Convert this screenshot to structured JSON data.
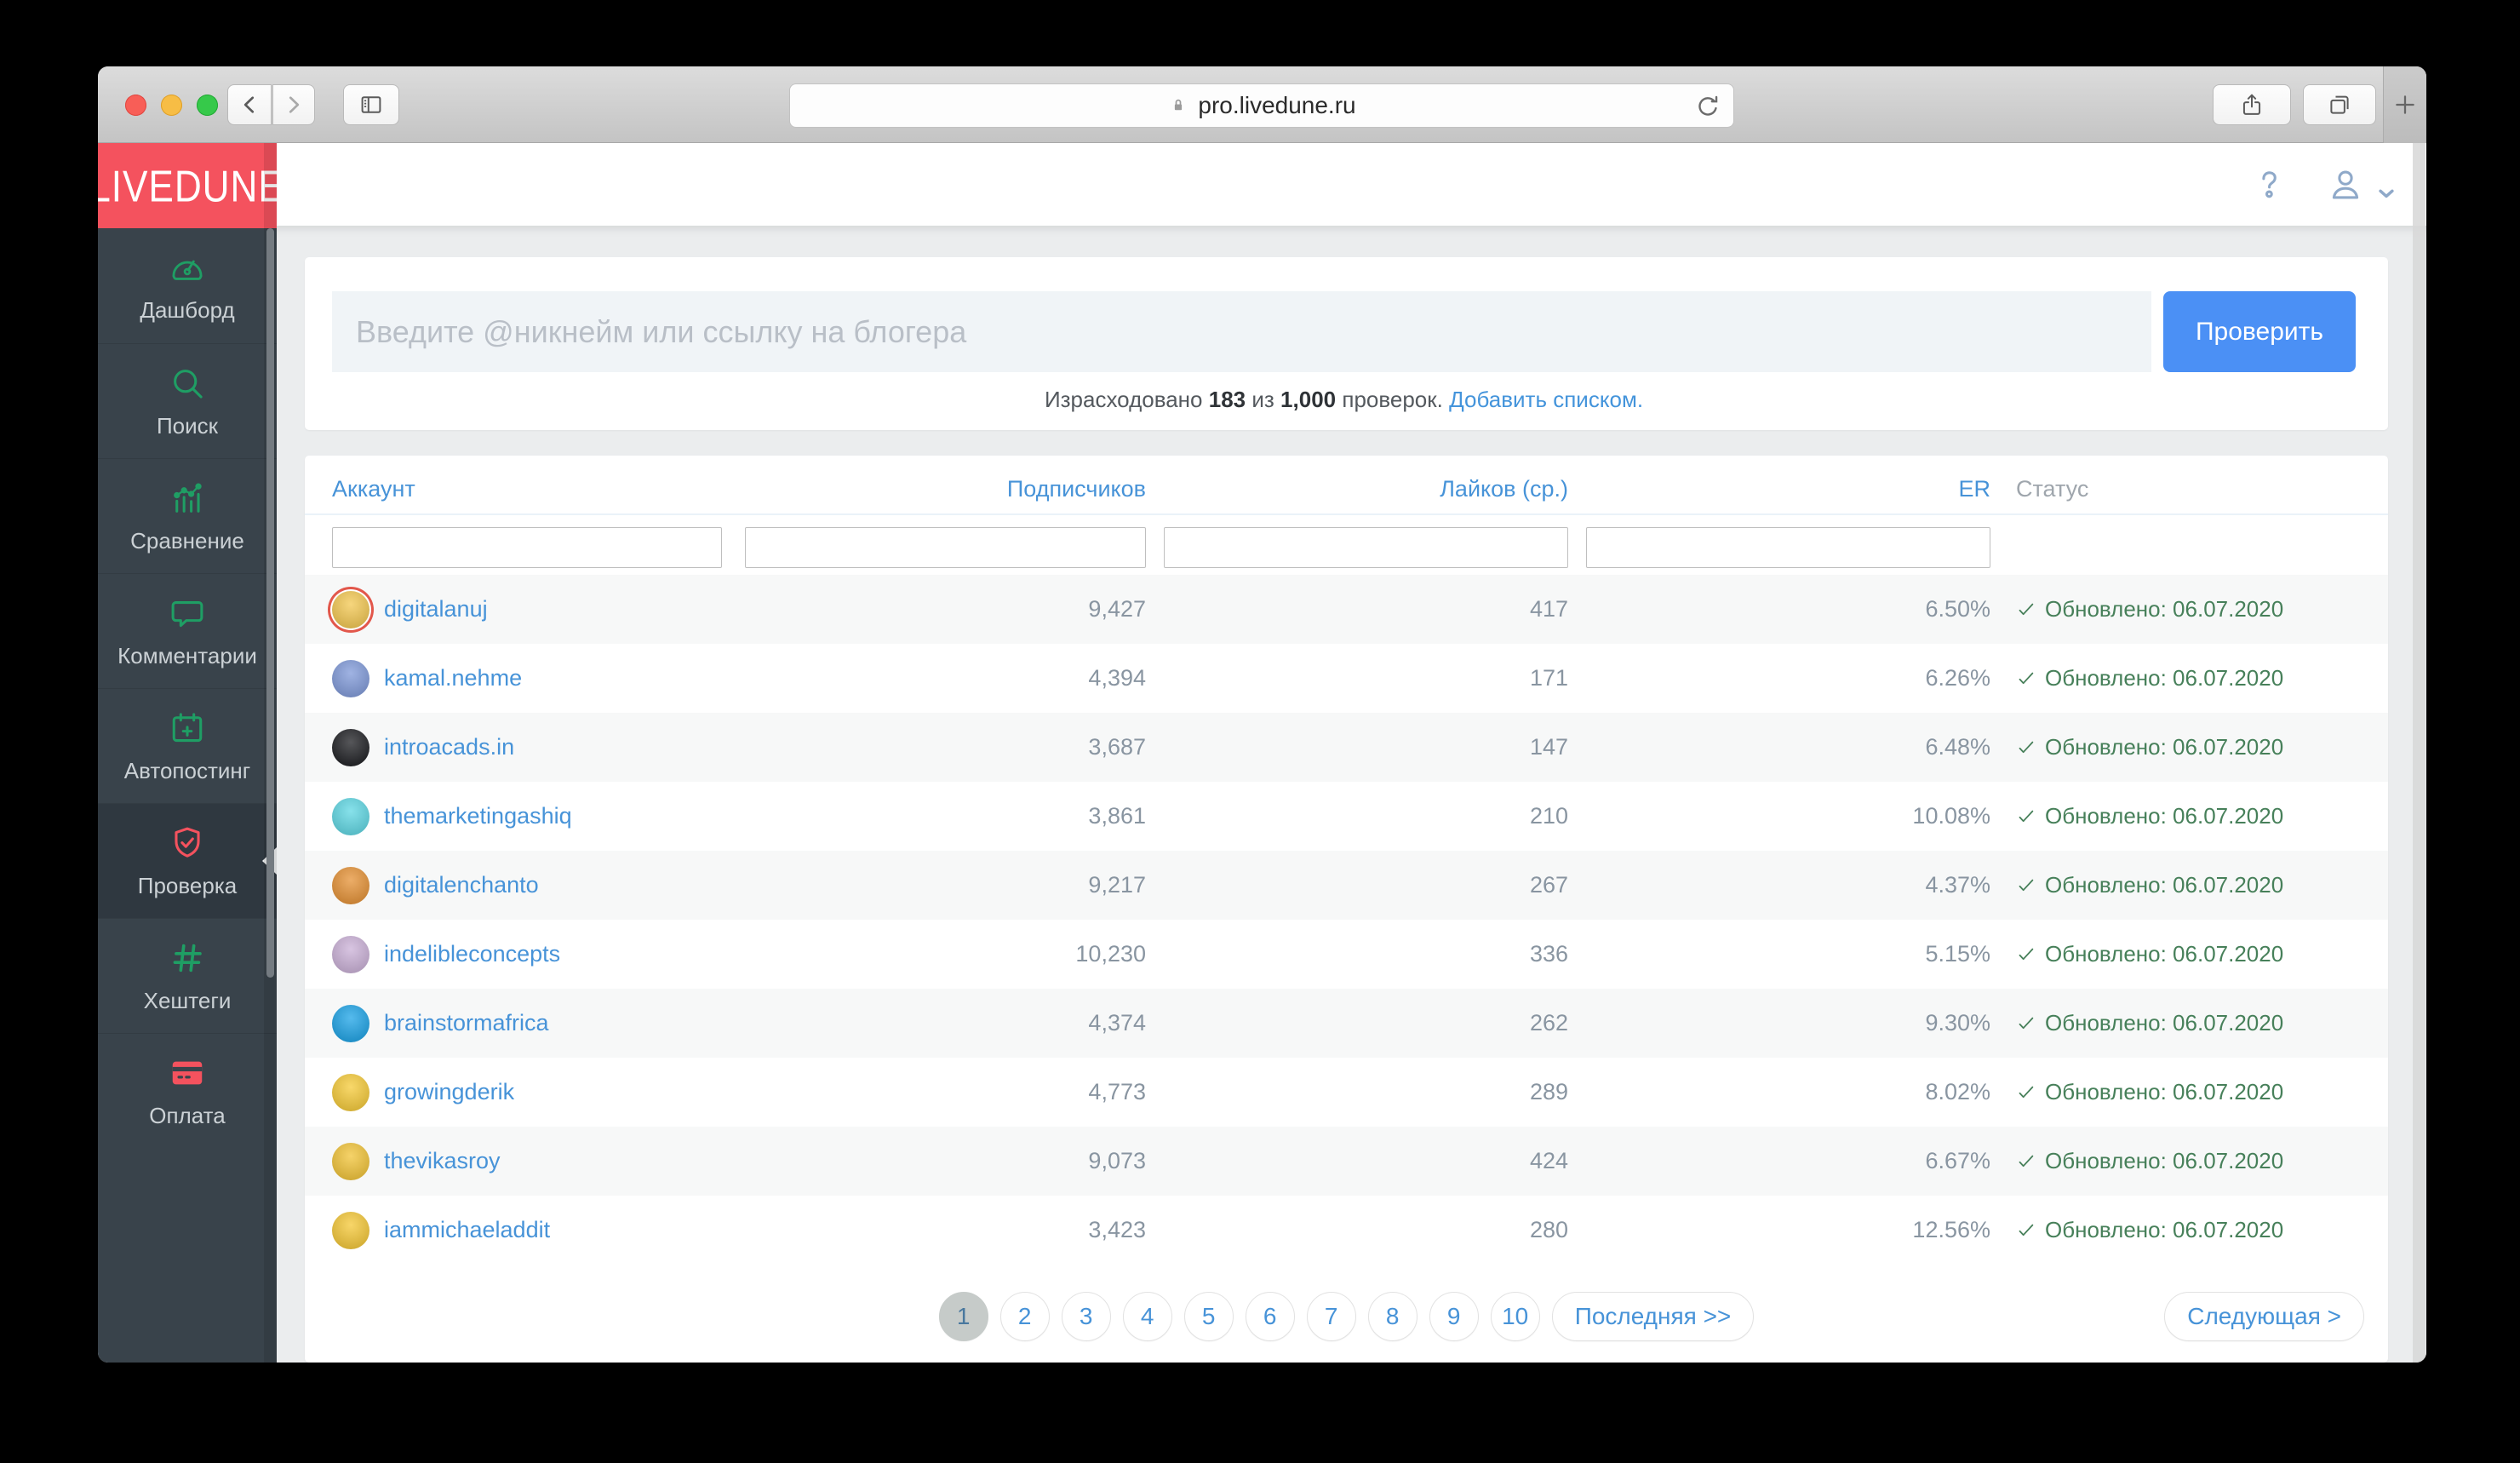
{
  "browser": {
    "url": "pro.livedune.ru",
    "icons": {
      "back": "chevron-left",
      "forward": "chevron-right",
      "sidebar_toggle": "sidebar-panel",
      "secure": "lock",
      "reload": "reload-arrow",
      "share": "share-up-arrow",
      "tabs": "overlapping-squares",
      "new_tab": "plus"
    }
  },
  "logo": "LIVEDUNE",
  "header": {
    "help_icon": "question-mark",
    "account_icon": "user-silhouette",
    "account_chevron": "chevron-down"
  },
  "sidebar": {
    "items": [
      {
        "label": "Дашборд",
        "icon": "dashboard-gauge-icon",
        "color": "green",
        "active": false
      },
      {
        "label": "Поиск",
        "icon": "search-icon",
        "color": "green",
        "active": false
      },
      {
        "label": "Сравнение",
        "icon": "bar-chart-icon",
        "color": "green",
        "active": false
      },
      {
        "label": "Комментарии",
        "icon": "comment-icon",
        "color": "green",
        "active": false
      },
      {
        "label": "Автопостинг",
        "icon": "calendar-plus-icon",
        "color": "green",
        "active": false
      },
      {
        "label": "Проверка",
        "icon": "shield-check-icon",
        "color": "red",
        "active": true
      },
      {
        "label": "Хештеги",
        "icon": "hashtag-icon",
        "color": "green",
        "active": false
      },
      {
        "label": "Оплата",
        "icon": "credit-card-icon",
        "color": "red",
        "active": false
      }
    ]
  },
  "search": {
    "placeholder": "Введите @никнейм или ссылку на блогера",
    "button": "Проверить",
    "usage_prefix": "Израсходовано",
    "usage_used": "183",
    "usage_mid": "из",
    "usage_total": "1,000",
    "usage_suffix": "проверок.",
    "usage_link": "Добавить списком."
  },
  "table": {
    "columns": [
      "Аккаунт",
      "Подписчиков",
      "Лайков (ср.)",
      "ER",
      "Статус"
    ],
    "status_check_icon": "checkmark",
    "rows": [
      {
        "username": "digitalanuj",
        "followers": "9,427",
        "likes": "417",
        "er": "6.50%",
        "status": "Обновлено: 06.07.2020",
        "avatar_color": "#F3C64B",
        "avatar_ring": true
      },
      {
        "username": "kamal.nehme",
        "followers": "4,394",
        "likes": "171",
        "er": "6.26%",
        "status": "Обновлено: 06.07.2020",
        "avatar_color": "#7B96D8",
        "avatar_ring": false
      },
      {
        "username": "introacads.in",
        "followers": "3,687",
        "likes": "147",
        "er": "6.48%",
        "status": "Обновлено: 06.07.2020",
        "avatar_color": "#15161A",
        "avatar_ring": false
      },
      {
        "username": "themarketingashiq",
        "followers": "3,861",
        "likes": "210",
        "er": "10.08%",
        "status": "Обновлено: 06.07.2020",
        "avatar_color": "#59D6E3",
        "avatar_ring": false
      },
      {
        "username": "digitalenchanto",
        "followers": "9,217",
        "likes": "267",
        "er": "4.37%",
        "status": "Обновлено: 06.07.2020",
        "avatar_color": "#E58E2E",
        "avatar_ring": false
      },
      {
        "username": "indelibleconcepts",
        "followers": "10,230",
        "likes": "336",
        "er": "5.15%",
        "status": "Обновлено: 06.07.2020",
        "avatar_color": "#C9AED6",
        "avatar_ring": false
      },
      {
        "username": "brainstormafrica",
        "followers": "4,374",
        "likes": "262",
        "er": "9.30%",
        "status": "Обновлено: 06.07.2020",
        "avatar_color": "#14A0E6",
        "avatar_ring": false
      },
      {
        "username": "growingderik",
        "followers": "4,773",
        "likes": "289",
        "er": "8.02%",
        "status": "Обновлено: 06.07.2020",
        "avatar_color": "#F6C931",
        "avatar_ring": false
      },
      {
        "username": "thevikasroy",
        "followers": "9,073",
        "likes": "424",
        "er": "6.67%",
        "status": "Обновлено: 06.07.2020",
        "avatar_color": "#F2C230",
        "avatar_ring": false
      },
      {
        "username": "iammichaeladdit",
        "followers": "3,423",
        "likes": "280",
        "er": "12.56%",
        "status": "Обновлено: 06.07.2020",
        "avatar_color": "#F5C62F",
        "avatar_ring": false
      }
    ]
  },
  "pagination": {
    "pages": [
      "1",
      "2",
      "3",
      "4",
      "5",
      "6",
      "7",
      "8",
      "9",
      "10"
    ],
    "active_page": "1",
    "last_label": "Последняя >>",
    "next_label": "Следующая >"
  },
  "colors": {
    "brand_red": "#F4525E",
    "sidebar_dark": "#39434B",
    "icon_green": "#1F9E64",
    "accent_blue": "#4B90F5",
    "link_blue": "#4793D8",
    "status_green": "#47805A",
    "number_gray": "#8995A1",
    "input_bg": "#F0F4F7"
  }
}
